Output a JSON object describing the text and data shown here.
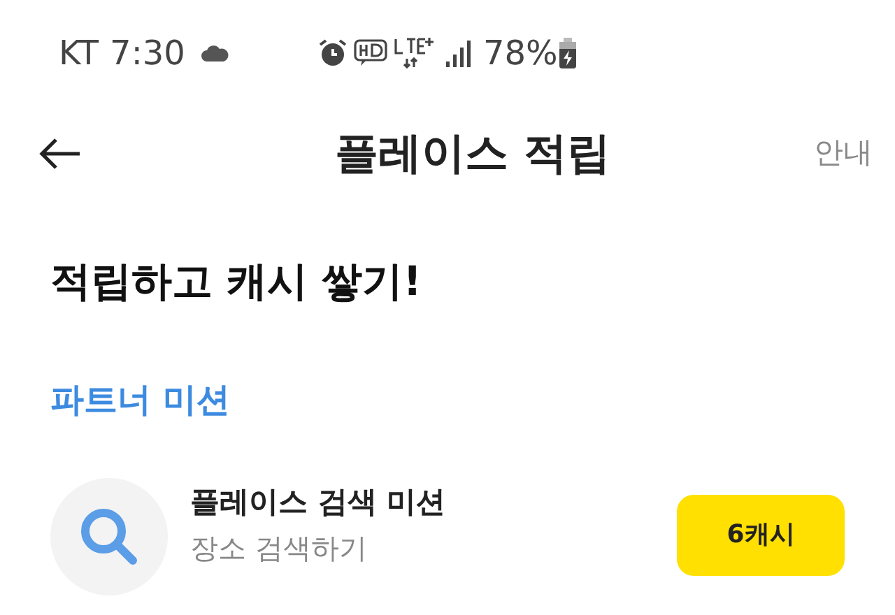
{
  "status_bar": {
    "carrier": "KT",
    "time": "7:30",
    "battery": "78%"
  },
  "header": {
    "title": "플레이스 적립",
    "action": "안내"
  },
  "headline": "적립하고 캐시 쌓기!",
  "section": {
    "title": "파트너 미션"
  },
  "missions": [
    {
      "title": "플레이스 검색 미션",
      "subtitle": "장소 검색하기",
      "reward": "6캐시"
    }
  ]
}
